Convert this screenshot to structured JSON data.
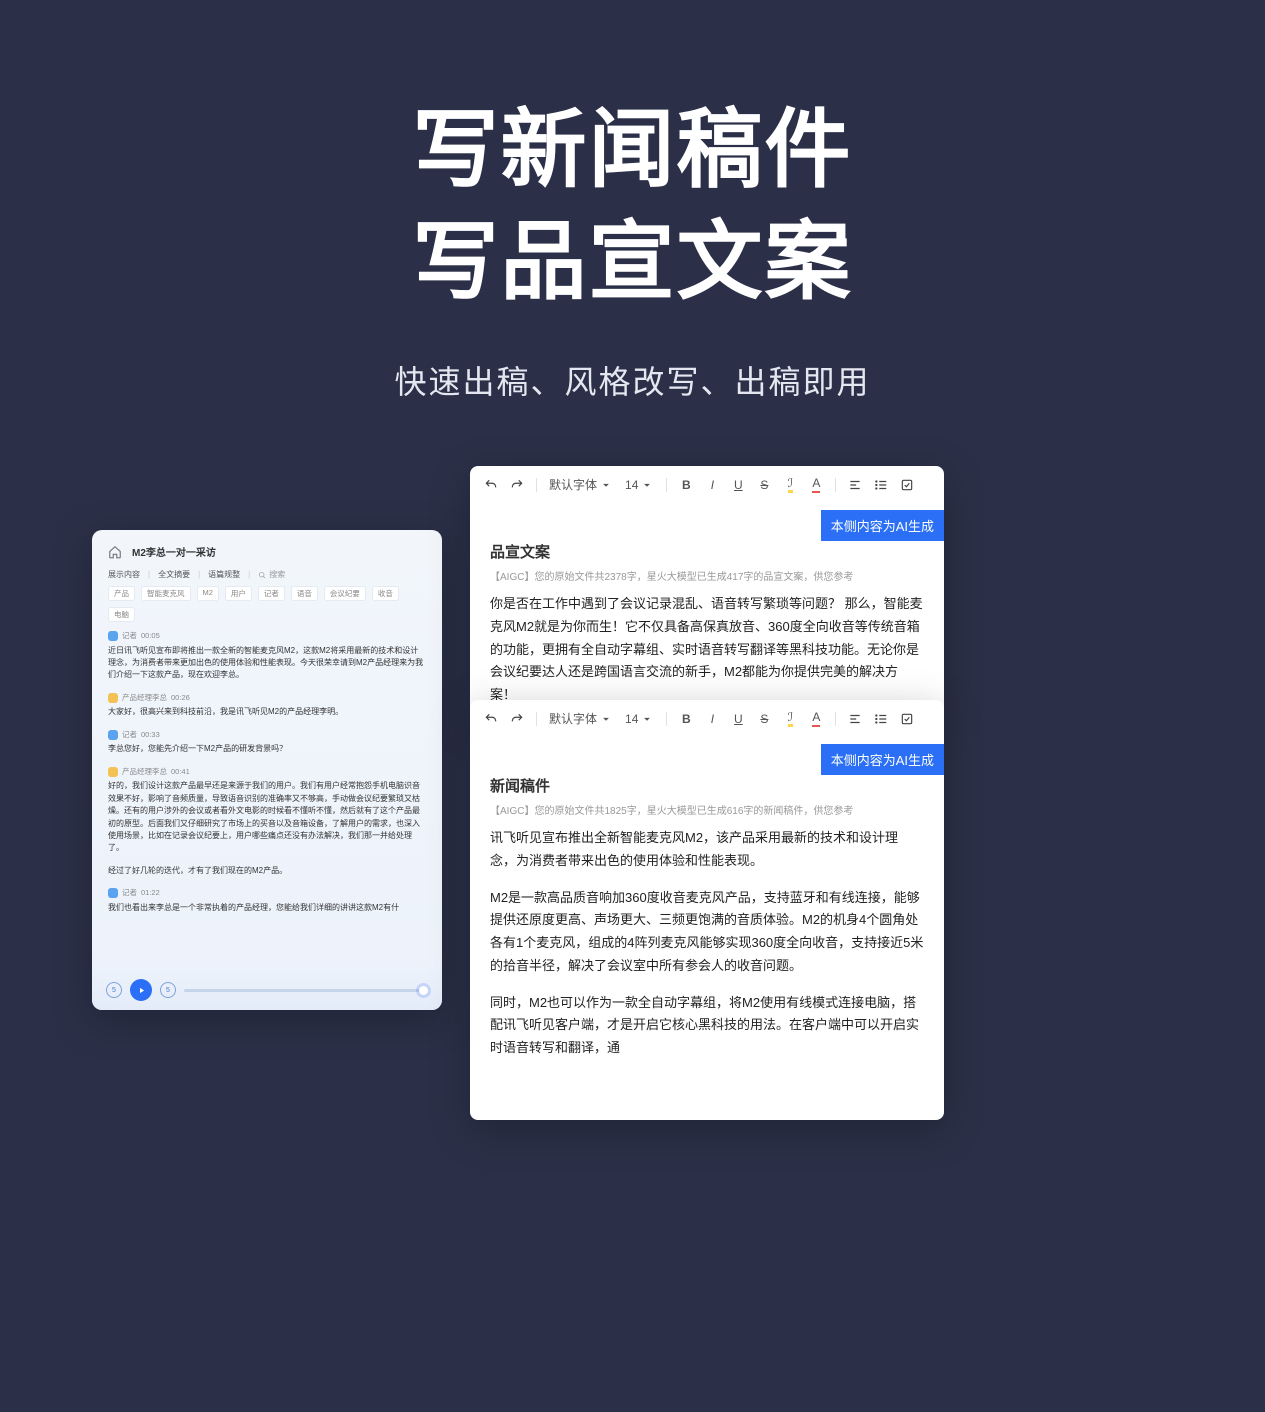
{
  "hero": {
    "title_line1": "写新闻稿件",
    "title_line2": "写品宣文案",
    "subtitle": "快速出稿、风格改写、出稿即用"
  },
  "transcript": {
    "title": "M2李总一对一采访",
    "tabs": {
      "t1": "展示内容",
      "t2": "全文摘要",
      "t3": "语篇规整"
    },
    "search_placeholder": "搜索",
    "chips": [
      "产品",
      "智能麦克风",
      "M2",
      "用户",
      "记者",
      "语音",
      "会议纪要",
      "收音",
      "电脑"
    ],
    "lines": [
      {
        "speaker": "记者",
        "time": "00:05",
        "avatar": "blue",
        "text": "近日讯飞听见宣布即将推出一款全新的智能麦克风M2，这款M2将采用最新的技术和设计理念，为消费者带来更加出色的使用体验和性能表现。今天很荣幸请到M2产品经理来为我们介绍一下这款产品，现在欢迎李总。"
      },
      {
        "speaker": "产品经理李总",
        "time": "00:26",
        "avatar": "yellow",
        "text": "大家好，很高兴来到科技前沿，我是讯飞听见M2的产品经理李明。"
      },
      {
        "speaker": "记者",
        "time": "00:33",
        "avatar": "blue",
        "text": "李总您好，您能先介绍一下M2产品的研发背景吗？"
      },
      {
        "speaker": "产品经理李总",
        "time": "00:41",
        "avatar": "yellow",
        "text": "好的，我们设计这款产品最早还是来源于我们的用户。我们有用户经常抱怨手机电脑识音效果不好，影响了音频质量，导致语音识别的准确率又不够高，手动做会议纪要繁琐又枯燥。还有的用户涉外的会议或者看外文电影的时候看不懂听不懂，然后就有了这个产品最初的原型。后面我们又仔细研究了市场上的买音以及音箱设备，了解用户的需求，也深入使用场景，比如在记录会议纪要上，用户哪些痛点还没有办法解决，我们那一并给处理了。"
      },
      {
        "speaker": "",
        "time": "",
        "avatar": "",
        "text": "经过了好几轮的迭代，才有了我们现在的M2产品。"
      },
      {
        "speaker": "记者",
        "time": "01:22",
        "avatar": "blue",
        "text": "我们也看出来李总是一个非常执着的产品经理，您能给我们详细的讲讲这款M2有什"
      }
    ],
    "rewind": "5",
    "forward": "5"
  },
  "editor": {
    "font_label": "默认字体",
    "font_size": "14"
  },
  "card1": {
    "ai_flag": "本侧内容为AI生成",
    "heading": "品宣文案",
    "meta": "【AIGC】您的原始文件共2378字，星火大模型已生成417字的品宣文案，供您参考",
    "body": "你是否在工作中遇到了会议记录混乱、语音转写繁琐等问题？ 那么，智能麦克风M2就是为你而生！它不仅具备高保真放音、360度全向收音等传统音箱的功能，更拥有全自动字幕组、实时语音转写翻译等黑科技功能。无论你是会议纪要达人还是跨国语言交流的新手，M2都能为你提供完美的解决方案！"
  },
  "card2": {
    "ai_flag": "本侧内容为AI生成",
    "heading": "新闻稿件",
    "meta": "【AIGC】您的原始文件共1825字，星火大模型已生成616字的新闻稿件，供您参考",
    "p1": "讯飞听见宣布推出全新智能麦克风M2，该产品采用最新的技术和设计理念，为消费者带来出色的使用体验和性能表现。",
    "p2": "M2是一款高品质音响加360度收音麦克风产品，支持蓝牙和有线连接，能够提供还原度更高、声场更大、三频更饱满的音质体验。M2的机身4个圆角处各有1个麦克风，组成的4阵列麦克风能够实现360度全向收音，支持接近5米的拾音半径，解决了会议室中所有参会人的收音问题。",
    "p3": "同时，M2也可以作为一款全自动字幕组，将M2使用有线模式连接电脑，搭配讯飞听见客户端，才是开启它核心黑科技的用法。在客户端中可以开启实时语音转写和翻译，通"
  }
}
